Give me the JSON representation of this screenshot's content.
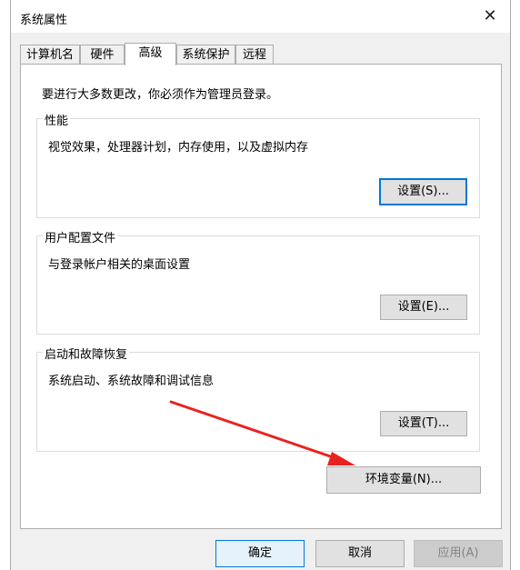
{
  "window": {
    "title": "系统属性"
  },
  "tabs": [
    {
      "label": "计算机名"
    },
    {
      "label": "硬件"
    },
    {
      "label": "高级"
    },
    {
      "label": "系统保护"
    },
    {
      "label": "远程"
    }
  ],
  "panel": {
    "notice": "要进行大多数更改，你必须作为管理员登录。",
    "performance": {
      "title": "性能",
      "description": "视觉效果，处理器计划，内存使用，以及虚拟内存",
      "button": "设置(S)..."
    },
    "user_profiles": {
      "title": "用户配置文件",
      "description": "与登录帐户相关的桌面设置",
      "button": "设置(E)..."
    },
    "startup_recovery": {
      "title": "启动和故障恢复",
      "description": "系统启动、系统故障和调试信息",
      "button": "设置(T)..."
    },
    "env_button": "环境变量(N)..."
  },
  "footer": {
    "ok": "确定",
    "cancel": "取消",
    "apply": "应用(A)"
  },
  "colors": {
    "annotation_arrow": "#e8231f",
    "focus_border": "#0078d7"
  }
}
